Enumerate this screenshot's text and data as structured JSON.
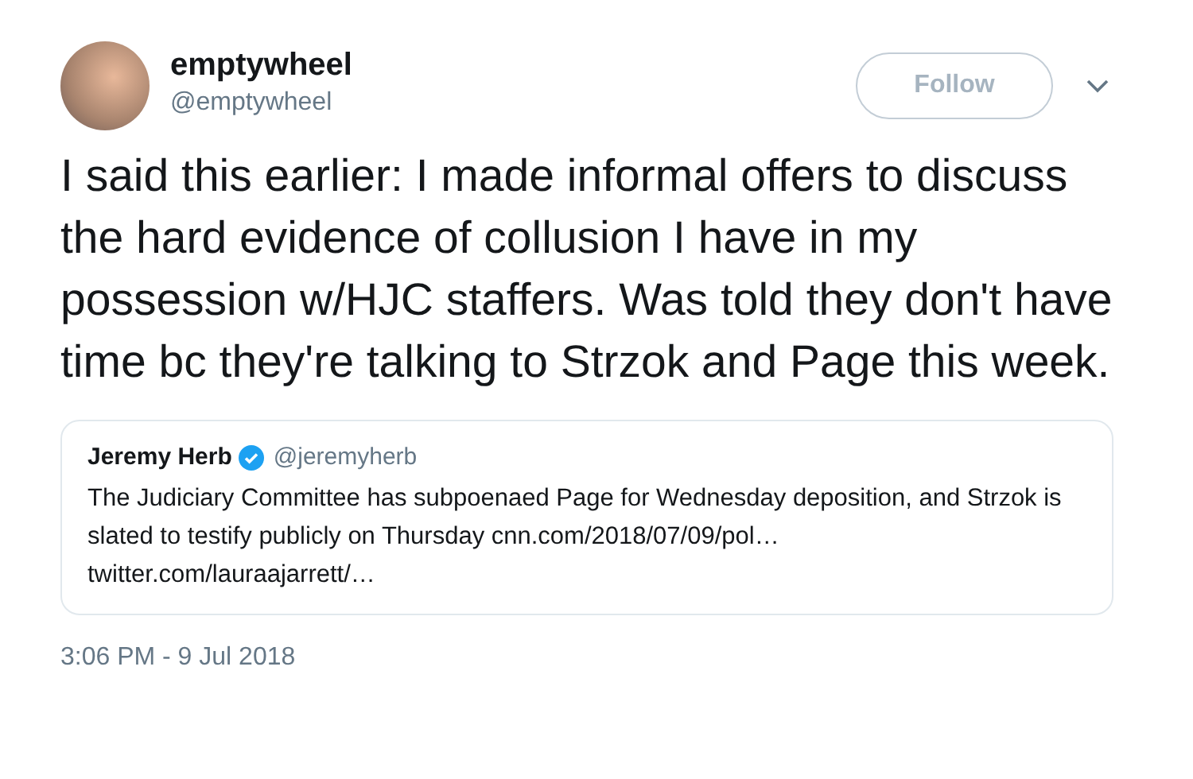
{
  "author": {
    "name": "emptywheel",
    "handle": "@emptywheel"
  },
  "follow_button": "Follow",
  "tweet_text": "I said this earlier: I made informal offers to discuss the hard evidence of collusion I have in my possession w/HJC staffers. Was told they don't have time bc they're talking to Strzok and Page this week.",
  "quoted_tweet": {
    "name": "Jeremy Herb",
    "verified": true,
    "handle": "@jeremyherb",
    "text": "The Judiciary Committee has subpoenaed Page for Wednesday deposition, and Strzok is slated to testify publicly on Thursday",
    "links": [
      "cnn.com/2018/07/09/pol…",
      "twitter.com/lauraajarrett/…"
    ]
  },
  "timestamp": "3:06 PM - 9 Jul 2018"
}
